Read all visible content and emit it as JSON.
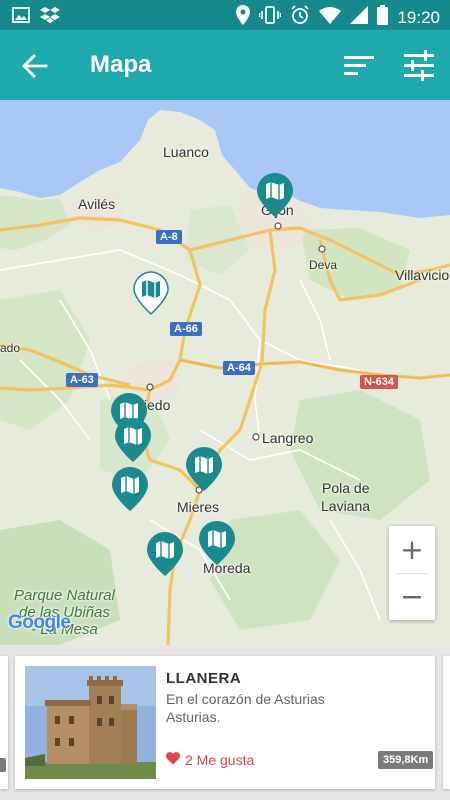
{
  "status_bar": {
    "time": "19:20",
    "left_icons": [
      "image-icon",
      "dropbox-icon"
    ],
    "right_icons": [
      "location-icon",
      "vibrate-icon",
      "alarm-icon",
      "wifi-icon",
      "signal-icon",
      "battery-icon"
    ]
  },
  "app_bar": {
    "title": "Mapa",
    "back_icon": "arrow-back-icon",
    "sort_icon": "sort-icon",
    "filter_icon": "tune-icon"
  },
  "colors": {
    "status_bar": "#16898d",
    "app_bar": "#1ea9ad",
    "marker": "#1a8a8f",
    "accent_red": "#e0424f"
  },
  "map": {
    "places": [
      "Luanco",
      "Avilés",
      "Gijón",
      "Deva",
      "Villavicio",
      "ado",
      "Oviedo",
      "Langreo",
      "Pola de",
      "Laviana",
      "Mieres",
      "Moreda"
    ],
    "roads": [
      "A-8",
      "A-66",
      "A-64",
      "A-63",
      "N-634"
    ],
    "park": [
      "Parque Natural",
      "de las Ubiñas",
      "- La Mesa"
    ],
    "attribution": "Google",
    "zoom_in": "+",
    "zoom_out": "−"
  },
  "card": {
    "name": "LLANERA",
    "description_line1": "En el corazón de Asturias",
    "description_line2": "Asturias.",
    "likes": "2 Me gusta",
    "distance": "359,8Km",
    "like_icon": "heart-icon"
  }
}
